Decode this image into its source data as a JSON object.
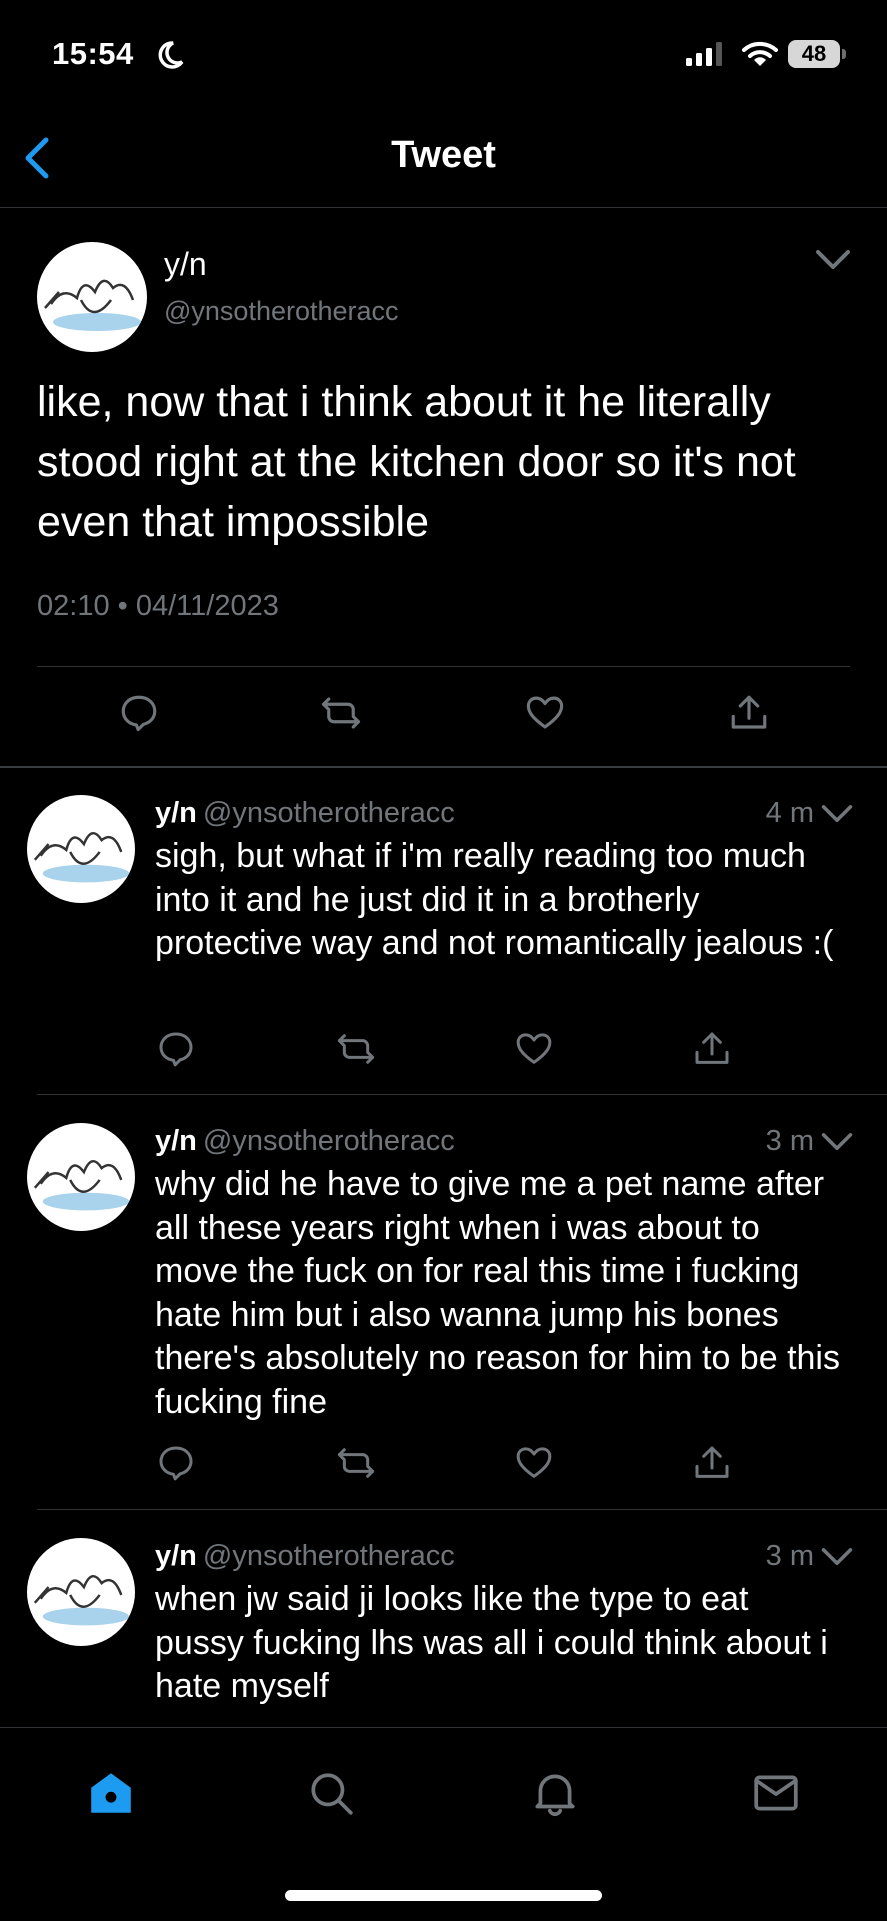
{
  "status_bar": {
    "time": "15:54",
    "battery": "48"
  },
  "header": {
    "title": "Tweet"
  },
  "main_tweet": {
    "name": "y/n",
    "handle": "@ynsotherotheracc",
    "text": "like, now that i think about it he literally stood right at the kitchen door so it's not even that impossible",
    "timestamp": "02:10 • 04/11/2023"
  },
  "replies": [
    {
      "name": "y/n",
      "handle": "@ynsotherotheracc",
      "age": "4 m",
      "text": "sigh, but what if i'm really reading too much into it and he just did it in a brotherly protective way and not romantically jealous :("
    },
    {
      "name": "y/n",
      "handle": "@ynsotherotheracc",
      "age": "3 m",
      "text": "why did he have to give me a pet name after all these years right when i was about to move the fuck on for real this time i fucking hate him but i also wanna jump his bones there's absolutely no reason for him to be this fucking fine"
    },
    {
      "name": "y/n",
      "handle": "@ynsotherotheracc",
      "age": "3 m",
      "text": "when jw said ji looks like the type to eat pussy fucking lhs was all i could think about i hate myself"
    }
  ],
  "colors": {
    "accent": "#1d9bf0",
    "muted": "#71767b",
    "divider": "#2f3336",
    "background": "#000000"
  },
  "tabbar": {
    "icons": [
      "home-icon",
      "search-icon",
      "notifications-icon",
      "messages-icon"
    ],
    "active": "home-icon"
  }
}
